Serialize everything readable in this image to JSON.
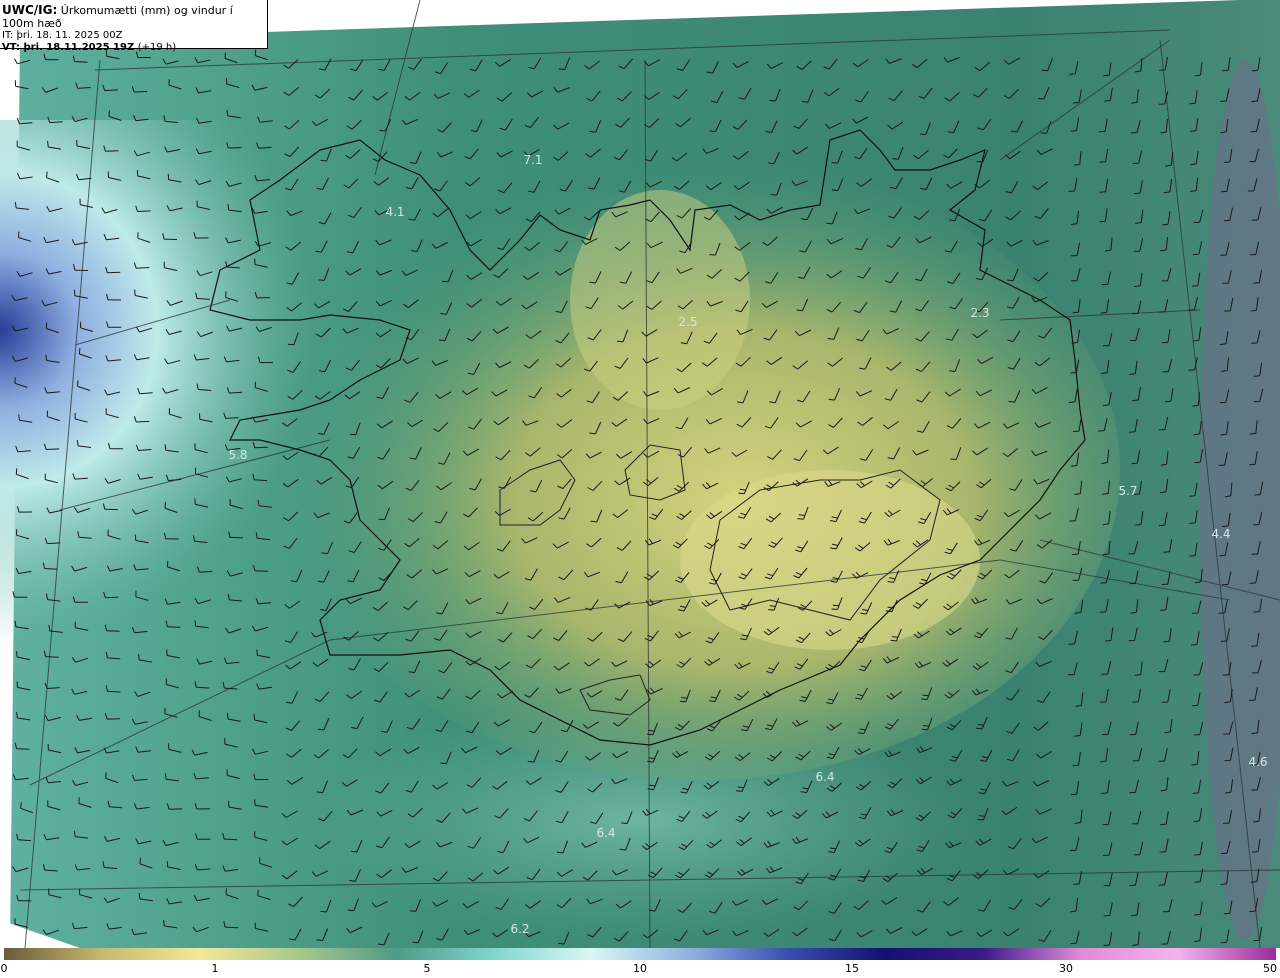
{
  "header": {
    "model": "UWC/IG:",
    "parameter": "Úrkomumætti (mm) og vindur í 100m hæð",
    "initial_time": "IT: þri. 18. 11. 2025 00Z",
    "valid_time_prefix": "VT:",
    "valid_time": "þri. 18.11.2025 19Z",
    "lead_time": "(+19 h)"
  },
  "map": {
    "value_labels": [
      {
        "id": "label-7-1",
        "text": "7.1"
      },
      {
        "id": "label-4-1",
        "text": "4.1"
      },
      {
        "id": "label-2-3",
        "text": "2.3"
      },
      {
        "id": "label-2-5",
        "text": "2.5"
      },
      {
        "id": "label-5-7",
        "text": "5.7"
      },
      {
        "id": "label-4-4",
        "text": "4.4"
      },
      {
        "id": "label-4-6",
        "text": "4.6"
      },
      {
        "id": "label-6-4-east",
        "text": "6.4"
      },
      {
        "id": "label-6-4-south",
        "text": "6.4"
      },
      {
        "id": "label-6-2",
        "text": "6.2"
      },
      {
        "id": "label-5-8",
        "text": "5.8"
      }
    ]
  },
  "colorbar": {
    "ticks": [
      "0",
      "1",
      "5",
      "10",
      "15",
      "30",
      "50"
    ],
    "colors": [
      "#6b5a3c",
      "#c9b870",
      "#f3e89b",
      "#a9c98a",
      "#4f9a86",
      "#7fd6cf",
      "#d9f7f3",
      "#8fb3e0",
      "#3a4fb0",
      "#151070",
      "#3a1a88",
      "#e08ad8",
      "#f4b4ee",
      "#9b2a9b"
    ]
  },
  "colors": {
    "coast": "#111111",
    "grid": "#2b3a38",
    "barb": "#1a1a1a",
    "sea_dark": "#2f7a66",
    "land_light": "#c8c47a"
  }
}
